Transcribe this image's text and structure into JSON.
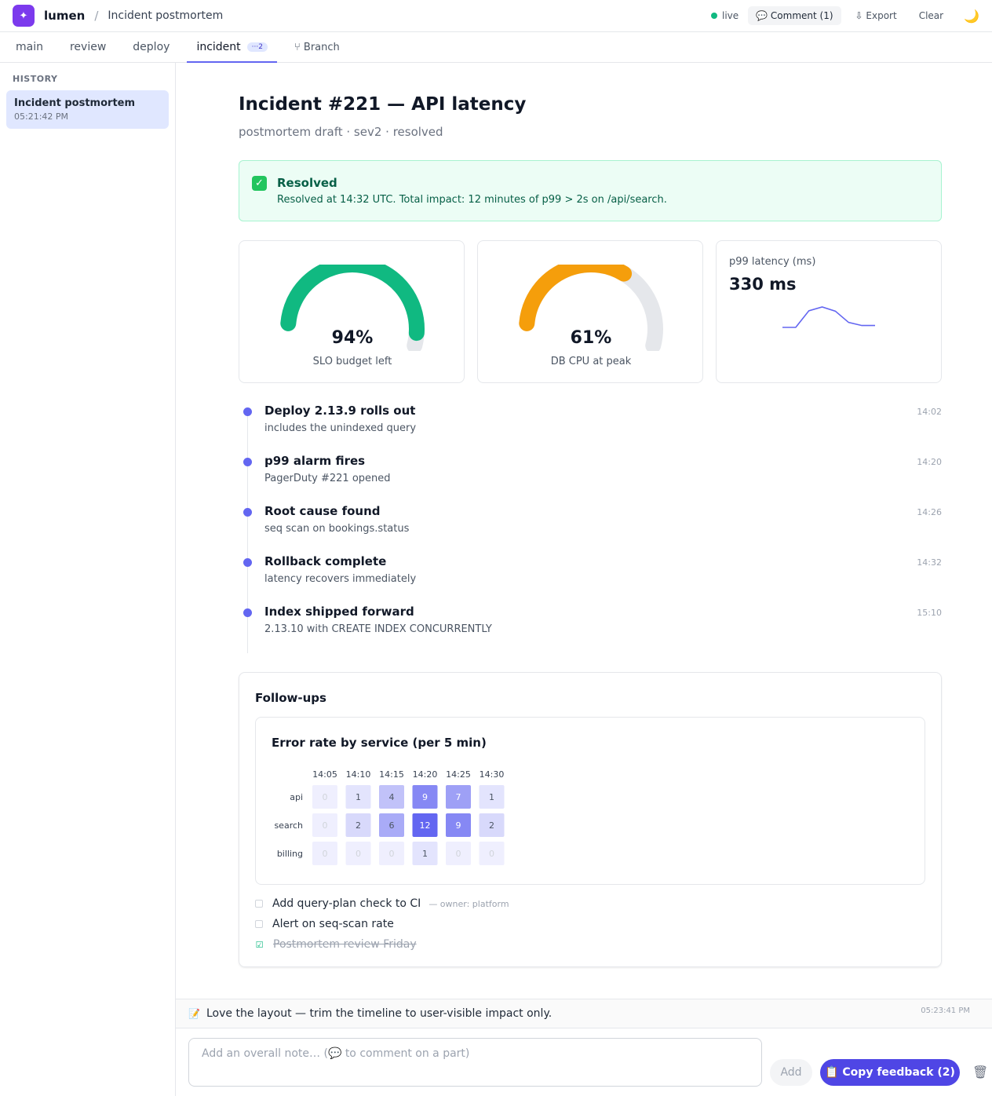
{
  "topbar": {
    "logo_glyph": "✦",
    "brand": "lumen",
    "breadcrumb": "Incident postmortem",
    "live_label": "live",
    "comment_label": "💬 Comment (1)",
    "export_label": "⇩ Export",
    "clear_label": "Clear",
    "theme_glyph": "🌙"
  },
  "tabs": [
    {
      "label": "main"
    },
    {
      "label": "review"
    },
    {
      "label": "deploy"
    },
    {
      "label": "incident",
      "badge": "···2",
      "active": true
    }
  ],
  "branch_label": "⑂ Branch",
  "sidebar": {
    "heading": "HISTORY",
    "items": [
      {
        "title": "Incident postmortem",
        "time": "05:21:42 PM"
      }
    ]
  },
  "page": {
    "title": "Incident #221 — API latency",
    "subtitle": "postmortem draft · sev2 · resolved"
  },
  "banner": {
    "icon_glyph": "✓",
    "title": "Resolved",
    "text": "Resolved at 14:32 UTC. Total impact: 12 minutes of p99 > 2s on /api/search."
  },
  "metrics": {
    "slo": {
      "value_text": "94%",
      "fraction": 0.94,
      "label": "SLO budget left",
      "color": "#10b981"
    },
    "cpu": {
      "value_text": "61%",
      "fraction": 0.61,
      "label": "DB CPU at peak",
      "color": "#f59e0b"
    },
    "track_color": "#e5e7eb",
    "latency": {
      "label": "p99 latency (ms)",
      "value_text": "330 ms",
      "spark": [
        330,
        330,
        1650,
        1950,
        1620,
        720,
        480,
        480
      ],
      "color": "#6366f1"
    }
  },
  "timeline": [
    {
      "title": "Deploy 2.13.9 rolls out",
      "desc": "includes the unindexed query",
      "time": "14:02"
    },
    {
      "title": "p99 alarm fires",
      "desc": "PagerDuty #221 opened",
      "time": "14:20"
    },
    {
      "title": "Root cause found",
      "desc": "seq scan on bookings.status",
      "time": "14:26"
    },
    {
      "title": "Rollback complete",
      "desc": "latency recovers immediately",
      "time": "14:32"
    },
    {
      "title": "Index shipped forward",
      "desc": "2.13.10 with CREATE INDEX CONCURRENTLY",
      "time": "15:10"
    }
  ],
  "followups": {
    "title": "Follow-ups",
    "tasks": [
      {
        "text": "Add query-plan check to CI",
        "owner": "— owner: platform",
        "done": false
      },
      {
        "text": "Alert on seq-scan rate",
        "owner": "",
        "done": false
      },
      {
        "text": "Postmortem review Friday",
        "owner": "",
        "done": true
      }
    ]
  },
  "chart_data": {
    "type": "heatmap",
    "title": "Error rate by service (per 5 min)",
    "x": [
      "14:05",
      "14:10",
      "14:15",
      "14:20",
      "14:25",
      "14:30"
    ],
    "y": [
      "api",
      "search",
      "billing"
    ],
    "values": [
      [
        0,
        1,
        4,
        9,
        7,
        1
      ],
      [
        0,
        2,
        6,
        12,
        9,
        2
      ],
      [
        0,
        0,
        0,
        1,
        0,
        0
      ]
    ],
    "vmax": 12,
    "color": "#6366f1"
  },
  "feedback": {
    "icon_glyph": "📝",
    "text": "Love the layout — trim the timeline to user-visible impact only.",
    "time": "05:23:41 PM"
  },
  "composer": {
    "placeholder": "Add an overall note… (💬 to comment on a part)",
    "add_label": "Add",
    "copy_label": "📋 Copy feedback (2)",
    "trash_glyph": "🗑"
  }
}
